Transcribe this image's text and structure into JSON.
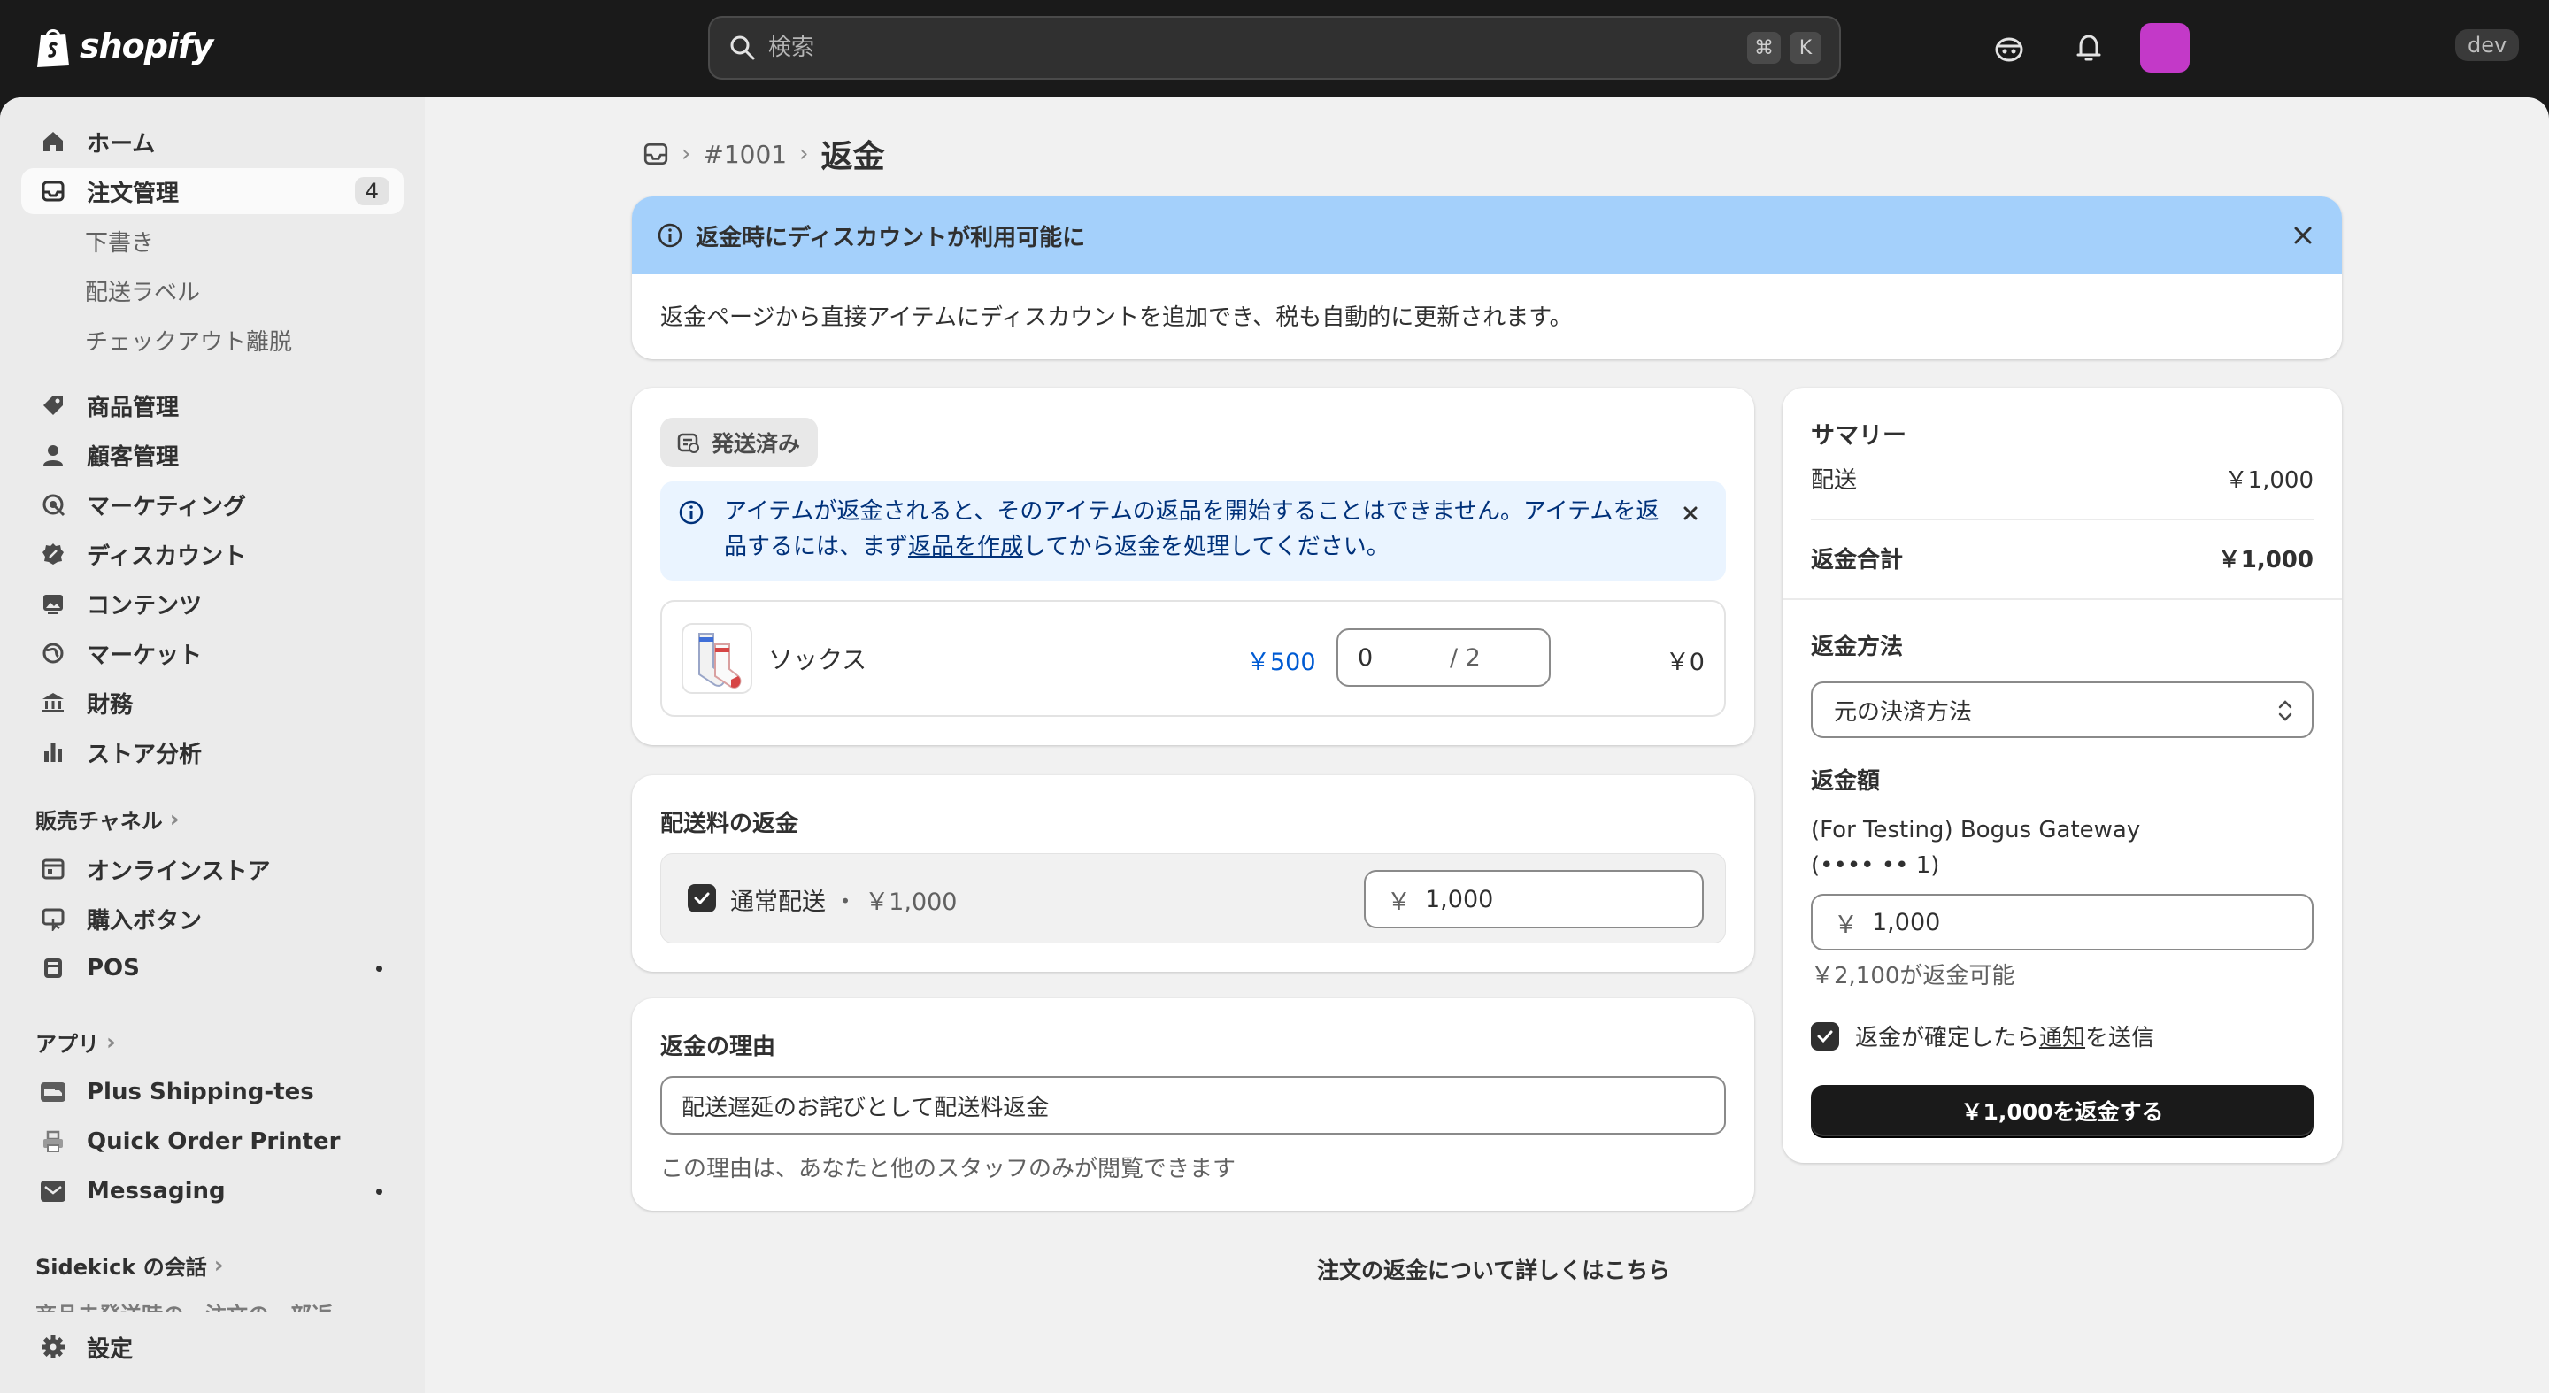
{
  "topbar": {
    "brand": "shopify",
    "search_placeholder": "検索",
    "shortcut_cmd": "⌘",
    "shortcut_key": "K",
    "env_badge": "dev"
  },
  "sidebar": {
    "items": [
      {
        "label": "ホーム",
        "icon": "home-icon"
      },
      {
        "label": "注文管理",
        "icon": "inbox-icon",
        "badge": "4"
      },
      {
        "label": "商品管理",
        "icon": "tag-icon"
      },
      {
        "label": "顧客管理",
        "icon": "person-icon"
      },
      {
        "label": "マーケティング",
        "icon": "target-icon"
      },
      {
        "label": "ディスカウント",
        "icon": "discount-icon"
      },
      {
        "label": "コンテンツ",
        "icon": "image-icon"
      },
      {
        "label": "マーケット",
        "icon": "globe-icon"
      },
      {
        "label": "財務",
        "icon": "bank-icon"
      },
      {
        "label": "ストア分析",
        "icon": "bar-chart-icon"
      }
    ],
    "order_subitems": [
      "下書き",
      "配送ラベル",
      "チェックアウト離脱"
    ],
    "sales_channels_heading": "販売チャネル",
    "sales_channels": [
      {
        "label": "オンラインストア",
        "icon": "store-icon"
      },
      {
        "label": "購入ボタン",
        "icon": "buy-button-icon"
      },
      {
        "label": "POS",
        "icon": "pos-icon"
      }
    ],
    "apps_heading": "アプリ",
    "apps": [
      {
        "label": "Plus Shipping-tes",
        "icon": "truck-app-icon"
      },
      {
        "label": "Quick Order Printer",
        "icon": "printer-app-icon"
      },
      {
        "label": "Messaging",
        "icon": "mail-app-icon"
      }
    ],
    "sidekick_heading": "Sidekick の会話",
    "sidekick_preview": "商品未発送時の　注文の一部返",
    "settings_label": "設定"
  },
  "breadcrumb": {
    "order_number": "#1001",
    "title": "返金"
  },
  "banner": {
    "title": "返金時にディスカウントが利用可能に",
    "body": "返金ページから直接アイテムにディスカウントを追加でき、税も自動的に更新されます。"
  },
  "fulfilled": {
    "status_label": "発送済み",
    "notice_part1": "アイテムが返金されると、そのアイテムの返品を開始することはできません。アイテムを返品するには、まず",
    "notice_link": "返品を作成",
    "notice_part2": "してから返金を処理してください。",
    "item": {
      "name": "ソックス",
      "price": "￥500",
      "quantity": "0",
      "max_quantity": "/ 2",
      "total": "￥0"
    }
  },
  "shipping_refund": {
    "title": "配送料の返金",
    "method_label": "通常配送",
    "separator": "・",
    "method_price": "￥1,000",
    "currency_symbol": "￥",
    "amount": "1,000"
  },
  "reason": {
    "title": "返金の理由",
    "value": "配送遅延のお詫びとして配送料返金",
    "help": "この理由は、あなたと他のスタッフのみが閲覧できます"
  },
  "summary": {
    "title": "サマリー",
    "shipping_label": "配送",
    "shipping_value": "￥1,000",
    "total_label": "返金合計",
    "total_value": "￥1,000",
    "method_heading": "返金方法",
    "method_value": "元の決済方法",
    "amount_heading": "返金額",
    "gateway_line1": "(For Testing) Bogus Gateway",
    "gateway_line2": "(•••• •• 1)",
    "currency_symbol": "￥",
    "amount": "1,000",
    "available": "￥2,100が返金可能",
    "notify_part1": "返金が確定したら",
    "notify_link": "通知",
    "notify_part2": "を送信",
    "refund_button": "￥1,000を返金する"
  },
  "footer_link": "注文の返金について詳しくはこちら",
  "colors": {
    "topbar_bg": "#1a1a1a",
    "banner_bg": "#a4d0fb",
    "notice_bg": "#eaf4ff",
    "link_blue": "#005bd3",
    "avatar": "#c339c8",
    "primary_button": "#1a1a1a"
  }
}
